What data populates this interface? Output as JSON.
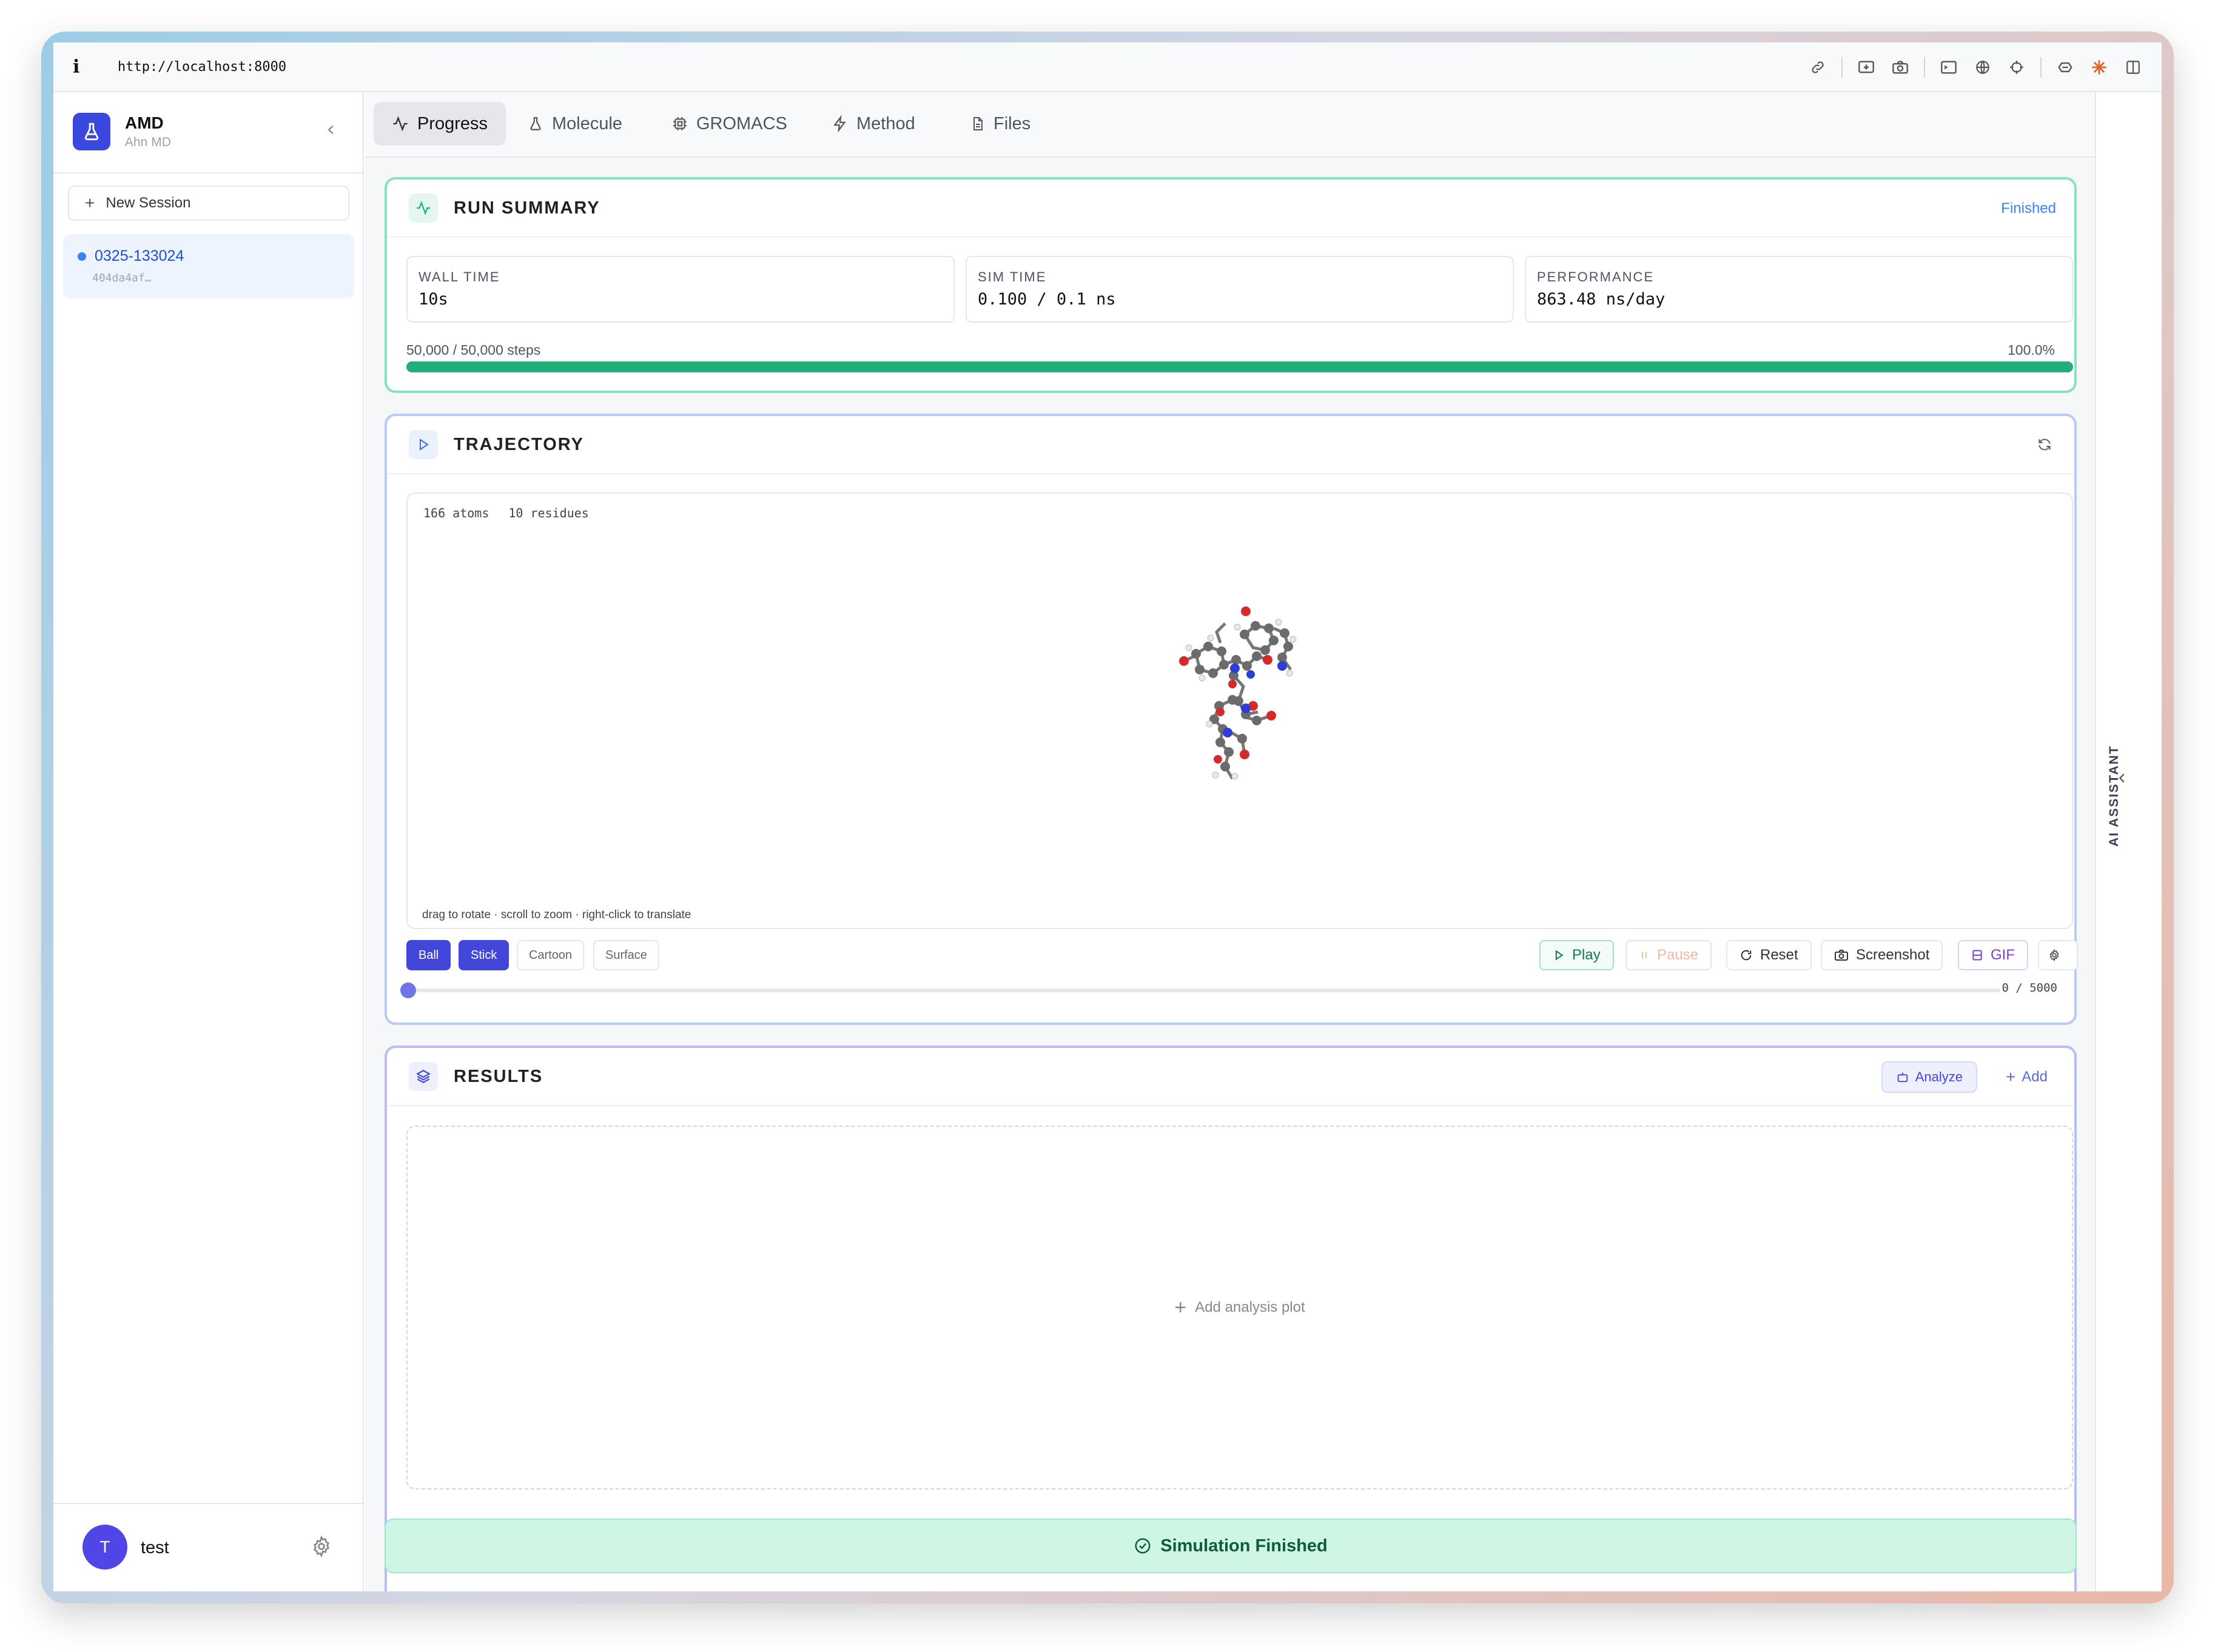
{
  "browser": {
    "info_glyph": "i",
    "url": "http://localhost:8000",
    "toolbar_icons": [
      "link-icon",
      "save-screen-icon",
      "camera-icon",
      "terminal-icon",
      "globe-icon",
      "crosshair-icon",
      "extension-icon",
      "claude-icon",
      "sidebar-toggle-icon"
    ]
  },
  "sidebar": {
    "app_name": "AMD",
    "app_subtitle": "Ahn MD",
    "new_session_label": "New Session",
    "sessions": [
      {
        "id": "0325-133024",
        "hash": "404da4af…"
      }
    ],
    "user": {
      "initial": "T",
      "name": "test"
    }
  },
  "tabs": [
    {
      "label": "Progress",
      "icon": "activity-icon",
      "active": true
    },
    {
      "label": "Molecule",
      "icon": "flask-icon"
    },
    {
      "label": "GROMACS",
      "icon": "cpu-icon"
    },
    {
      "label": "Method",
      "icon": "zap-icon"
    },
    {
      "label": "Files",
      "icon": "file-icon"
    }
  ],
  "run_summary": {
    "title": "RUN SUMMARY",
    "status": "Finished",
    "stats": [
      {
        "label": "WALL TIME",
        "value": "10s"
      },
      {
        "label": "SIM TIME",
        "value": "0.100 / 0.1 ns"
      },
      {
        "label": "PERFORMANCE",
        "value": "863.48 ns/day"
      }
    ],
    "steps_text": "50,000 / 50,000 steps",
    "percent_text": "100.0%",
    "progress": 1.0,
    "accent": "#22ad79"
  },
  "trajectory": {
    "title": "TRAJECTORY",
    "atoms": "166 atoms",
    "residues": "10 residues",
    "hint": "drag to rotate · scroll to zoom · right-click to translate",
    "representations": [
      {
        "label": "Ball",
        "active": true
      },
      {
        "label": "Stick",
        "active": true
      },
      {
        "label": "Cartoon",
        "active": false
      },
      {
        "label": "Surface",
        "active": false
      }
    ],
    "controls": {
      "play": "Play",
      "pause": "Pause",
      "reset": "Reset",
      "screenshot": "Screenshot",
      "gif": "GIF"
    },
    "frame_text": "0 / 5000",
    "frame_position": 0
  },
  "results": {
    "title": "RESULTS",
    "analyze_label": "Analyze",
    "add_label": "Add",
    "placeholder": "Add analysis plot"
  },
  "footer_status": "Simulation Finished",
  "assistant": {
    "label": "AI ASSISTANT"
  }
}
